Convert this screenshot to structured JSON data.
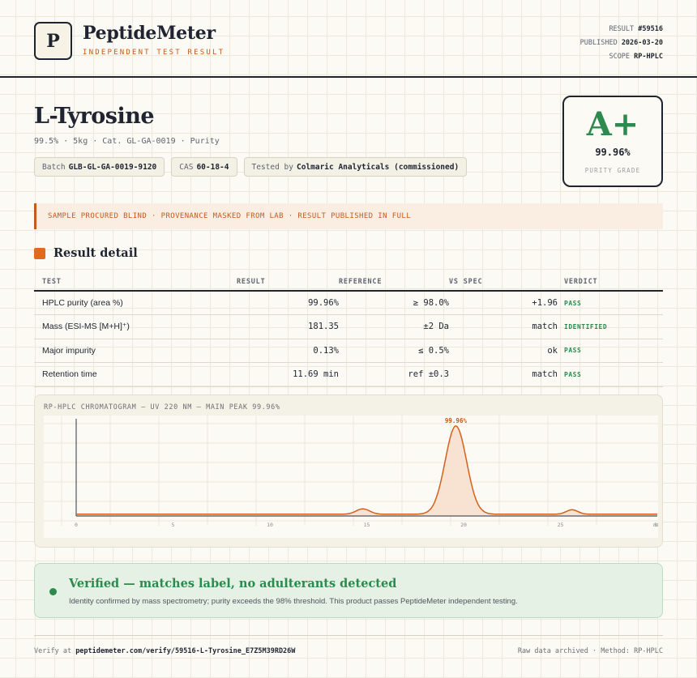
{
  "header": {
    "logo_letter": "P",
    "brand": "PeptideMeter",
    "brand_sub": "INDEPENDENT TEST RESULT",
    "result_label": "RESULT",
    "result_value": "#59516",
    "published_label": "PUBLISHED",
    "published_value": "2026-03-20",
    "scope_label": "SCOPE",
    "scope_value": "RP-HPLC"
  },
  "product": {
    "name": "L-Tyrosine",
    "subline": "99.5% · 5kg · Cat. GL-GA-0019 · Purity",
    "batch_label": "Batch",
    "batch_value": "GLB-GL-GA-0019-9120",
    "cas_label": "CAS",
    "cas_value": "60-18-4",
    "tested_label": "Tested by",
    "tested_value": "Colmaric Analyticals (commissioned)"
  },
  "grade": {
    "letter": "A+",
    "purity": "99.96%",
    "label": "PURITY GRADE",
    "color": "#2c8a4e"
  },
  "notice": "SAMPLE PROCURED BLIND · PROVENANCE MASKED FROM LAB · RESULT PUBLISHED IN FULL",
  "section_title": "Result detail",
  "table": {
    "headers": [
      "TEST",
      "RESULT",
      "REFERENCE",
      "VS SPEC",
      "VERDICT"
    ],
    "rows": [
      {
        "test": "HPLC purity (area %)",
        "result": "99.96%",
        "reference": "≥ 98.0%",
        "vs_spec": "+1.96",
        "verdict": "PASS"
      },
      {
        "test": "Mass (ESI-MS [M+H]⁺)",
        "result": "181.35",
        "reference": "±2 Da",
        "vs_spec": "match",
        "verdict": "IDENTIFIED"
      },
      {
        "test": "Major impurity",
        "result": "0.13%",
        "reference": "≤ 0.5%",
        "vs_spec": "ok",
        "verdict": "PASS"
      },
      {
        "test": "Retention time",
        "result": "11.69 min",
        "reference": "ref ±0.3",
        "vs_spec": "match",
        "verdict": "PASS"
      }
    ]
  },
  "chart_title": "RP-HPLC CHROMATOGRAM — UV 220 NM — MAIN PEAK 99.96%",
  "chart_data": {
    "type": "line",
    "title": "RP-HPLC CHROMATOGRAM — UV 220 NM — MAIN PEAK 99.96%",
    "xlim": [
      0,
      30
    ],
    "x_ticks": [
      "0",
      "5",
      "10",
      "15",
      "20",
      "25",
      "30",
      "min"
    ],
    "peaks": [
      {
        "center": 14.8,
        "height": 0.06,
        "width": 0.35
      },
      {
        "center": 19.6,
        "height": 0.99,
        "width": 0.55,
        "label": "99.96%"
      },
      {
        "center": 25.6,
        "height": 0.05,
        "width": 0.3
      }
    ],
    "baseline": 0.02,
    "line_color": "#d2601f",
    "fill_color": "#f8e3d3"
  },
  "verdict": {
    "title": "Verified — matches label, no adulterants detected",
    "body": "Identity confirmed by mass spectrometry; purity exceeds the 98% threshold. This product passes PeptideMeter independent testing."
  },
  "footer": {
    "verify_label": "Verify at",
    "verify_url": "peptidemeter.com/verify/59516-L-Tyrosine_E7Z5M39RD26W",
    "right": "Raw data archived · Method: RP-HPLC"
  }
}
